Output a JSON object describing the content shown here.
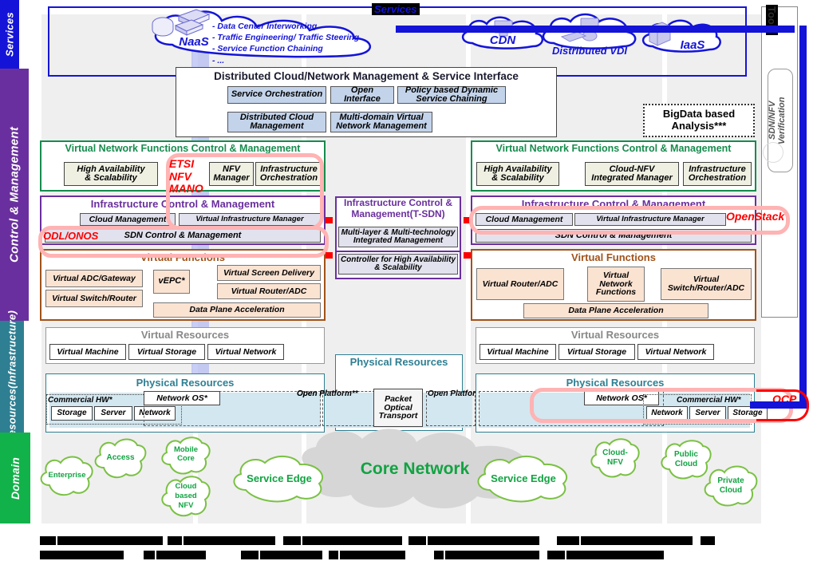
{
  "sidebar": {
    "bands": [
      {
        "key": "services",
        "label": "Services",
        "color": "#1414d8"
      },
      {
        "key": "control",
        "label": "Control & Management",
        "color": "#6a2f9e"
      },
      {
        "key": "resources",
        "label": "Resources(Infrastructure)",
        "color": "#2e7f92"
      },
      {
        "key": "domain",
        "label": "Domain",
        "color": "#12b24a"
      }
    ]
  },
  "services": {
    "tag": "Services",
    "naas_label": "NaaS",
    "naas_notes": "- Data Center Interworking\n- Traffic Engineering/  Traffic Steering\n- Service Function Chaining\n- ...",
    "clouds": [
      {
        "label": "CDN"
      },
      {
        "label": "Distributed VDI"
      },
      {
        "label": "IaaS"
      }
    ]
  },
  "tools": {
    "tag": "Tools",
    "items": [
      {
        "label": "SDN/NFV\nVerification"
      }
    ]
  },
  "orchestration": {
    "title": "Distributed Cloud/Network Management & Service Interface",
    "boxes": [
      {
        "label": "Service Orchestration"
      },
      {
        "label": "Open\nInterface"
      },
      {
        "label": "Policy based Dynamic\nService Chaining"
      },
      {
        "label": "Distributed Cloud\nManagement"
      },
      {
        "label": "Multi-domain Virtual\nNetwork Management"
      }
    ]
  },
  "bigdata": {
    "label": "BigData based\nAnalysis***"
  },
  "left_column": {
    "vnf_cm": {
      "title": "Virtual Network Functions Control & Management",
      "boxes": [
        {
          "label": "High Availability\n& Scalability"
        },
        {
          "label": "NFV\nManager"
        },
        {
          "label": "Infrastructure\nOrchestration"
        }
      ]
    },
    "infra_cm": {
      "title": "Infrastructure Control & Management",
      "boxes": [
        {
          "label": "Cloud Management"
        },
        {
          "label": "Virtual Infrastructure Manager"
        },
        {
          "label": "SDN Control & Management"
        }
      ]
    },
    "virtual_functions": {
      "title": "Virtual Functions",
      "boxes": [
        {
          "label": "Virtual ADC/Gateway"
        },
        {
          "label": "vEPC*"
        },
        {
          "label": "Virtual Screen Delivery"
        },
        {
          "label": "Virtual Switch/Router"
        },
        {
          "label": "Virtual Router/ADC"
        },
        {
          "label": "Data Plane Acceleration"
        }
      ]
    },
    "virtual_resources": {
      "title": "Virtual Resources",
      "boxes": [
        {
          "label": "Virtual Machine"
        },
        {
          "label": "Virtual Storage"
        },
        {
          "label": "Virtual Network"
        }
      ]
    },
    "physical_resources": {
      "title": "Physical Resources",
      "commercial_hw": "Commercial HW*",
      "open_platform": "Open Platform**",
      "network_os": "Network OS*",
      "boxes": [
        {
          "label": "Storage"
        },
        {
          "label": "Server"
        },
        {
          "label": "Network"
        }
      ]
    }
  },
  "center_column": {
    "infra_cm": {
      "title": "Infrastructure Control &\nManagement(T-SDN)",
      "boxes": [
        {
          "label": "Multi-layer & Multi-technology\nIntegrated Management"
        },
        {
          "label": "Controller for High Availability\n& Scalability"
        }
      ]
    },
    "physical_resources": {
      "title": "Physical Resources",
      "open_platform_left": "Open Platform**",
      "open_platform_right": "Open Platform**",
      "transport": "Packet\nOptical\nTransport"
    }
  },
  "right_column": {
    "vnf_cm": {
      "title": "Virtual Network Functions Control & Management",
      "boxes": [
        {
          "label": "High Availability\n& Scalability"
        },
        {
          "label": "Cloud-NFV\nIntegrated Manager"
        },
        {
          "label": "Infrastructure\nOrchestration"
        }
      ]
    },
    "infra_cm": {
      "title": "Infrastructure Control & Management",
      "boxes": [
        {
          "label": "Cloud Management"
        },
        {
          "label": "Virtual Infrastructure Manager"
        },
        {
          "label": "SDN Control & Management"
        }
      ]
    },
    "virtual_functions": {
      "title": "Virtual Functions",
      "boxes": [
        {
          "label": "Virtual Router/ADC"
        },
        {
          "label": "Virtual\nNetwork\nFunctions"
        },
        {
          "label": "Virtual\nSwitch/Router/ADC"
        },
        {
          "label": "Data Plane Acceleration"
        }
      ]
    },
    "virtual_resources": {
      "title": "Virtual Resources",
      "boxes": [
        {
          "label": "Virtual Machine"
        },
        {
          "label": "Virtual Storage"
        },
        {
          "label": "Virtual Network"
        }
      ]
    },
    "physical_resources": {
      "title": "Physical Resources",
      "commercial_hw": "Commercial HW*",
      "network_os": "Network OS*",
      "boxes": [
        {
          "label": "Network"
        },
        {
          "label": "Server"
        },
        {
          "label": "Storage"
        }
      ]
    }
  },
  "annotations": {
    "etsi": "ETSI\nNFV\nMANO",
    "odl": "ODL/ONOS",
    "openstack": "OpenStack",
    "ocp": "OCP"
  },
  "domain": {
    "clouds": [
      {
        "label": "Enterprise"
      },
      {
        "label": "Access"
      },
      {
        "label": "Mobile\nCore"
      },
      {
        "label": "Cloud\nbased\nNFV"
      },
      {
        "label": "Service Edge"
      },
      {
        "label": "Core Network"
      },
      {
        "label": "Service Edge"
      },
      {
        "label": "Cloud-\nNFV"
      },
      {
        "label": "Public\nCloud"
      },
      {
        "label": "Private\nCloud"
      }
    ]
  },
  "footnotes": {
    "redacted_rows": [
      [
        20,
        200,
        18,
        170,
        22,
        185,
        22,
        205,
        28,
        200,
        18
      ],
      [
        150,
        12,
        80,
        22,
        100,
        10,
        110,
        10,
        150,
        22,
        150
      ]
    ]
  },
  "colors": {
    "services_band": "#1414d8",
    "control_band": "#6a2f9e",
    "resources_band": "#2e7f92",
    "domain_band": "#12b24a",
    "vnf_green": "#178c4e",
    "infra_purple": "#6a2f9e",
    "vf_orange": "#a1521a",
    "vr_grey": "#808080",
    "pr_teal": "#2e7f92",
    "red_accent": "#ff0000",
    "blue_accent": "#1414d8",
    "cloud_green": "#7ac143"
  }
}
